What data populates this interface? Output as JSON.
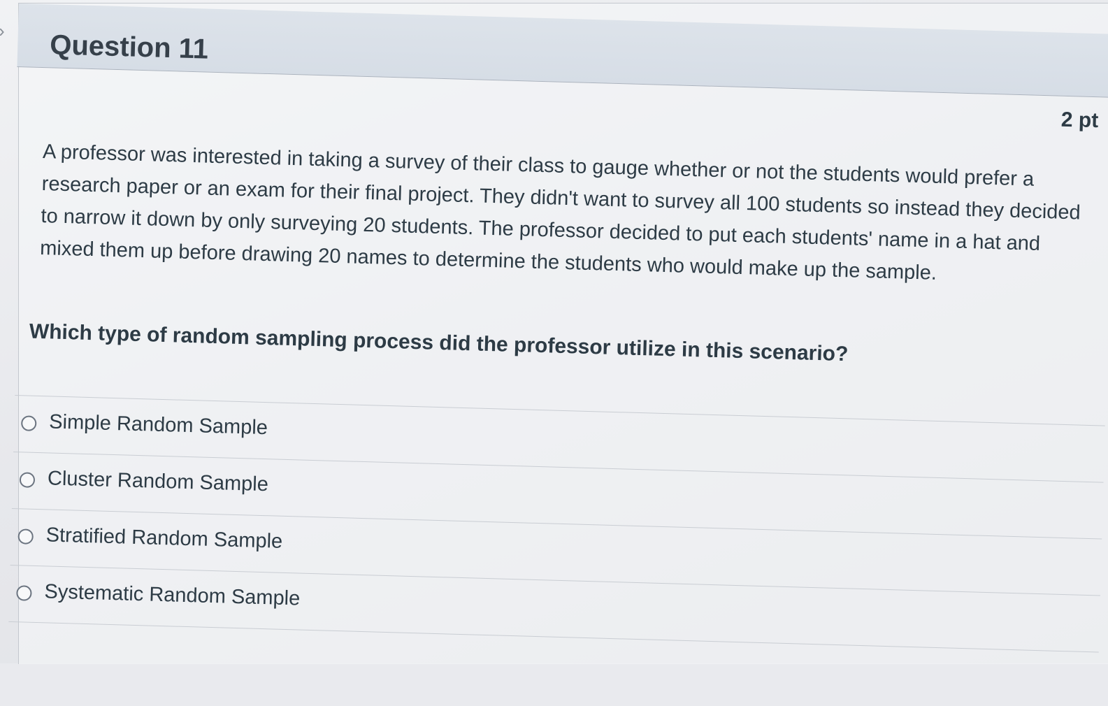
{
  "question": {
    "title": "Question 11",
    "points": "2 pt",
    "text": "A professor was interested in taking a survey of their class to gauge whether or not the students would prefer a research paper or an exam for their final project. They didn't want to survey all 100 students so instead they decided to narrow it down by only surveying 20 students. The professor decided to put each students' name in a hat and mixed them up before drawing 20 names to determine the students who would make up the sample.",
    "prompt": "Which type of random sampling process did the professor utilize in this scenario?"
  },
  "answers": [
    {
      "label": "Simple Random Sample",
      "selected": false
    },
    {
      "label": "Cluster Random Sample",
      "selected": false
    },
    {
      "label": "Stratified Random Sample",
      "selected": false
    },
    {
      "label": "Systematic Random Sample",
      "selected": false
    }
  ]
}
